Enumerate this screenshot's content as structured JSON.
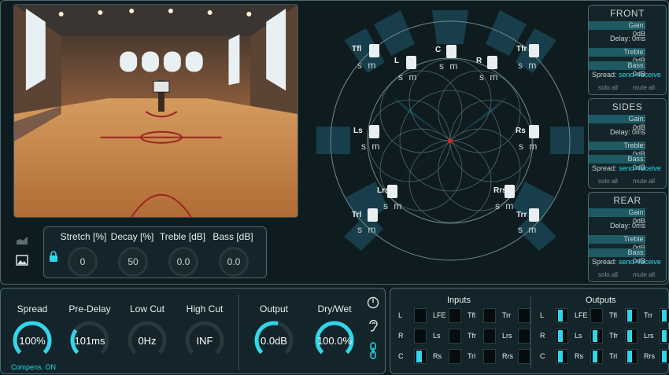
{
  "colors": {
    "accent": "#30d7ea",
    "bg": "#101d20",
    "panel": "#13252a",
    "border": "#4f6b70"
  },
  "reverb": {
    "params": [
      {
        "label": "Stretch [%]",
        "value": "0"
      },
      {
        "label": "Decay [%]",
        "value": "50"
      },
      {
        "label": "Treble [dB]",
        "value": "0.0"
      },
      {
        "label": "Bass [dB]",
        "value": "0.0"
      }
    ]
  },
  "speakers": {
    "mute_label": "s m",
    "items": [
      {
        "id": "Tfl",
        "name": "Tfl"
      },
      {
        "id": "L",
        "name": "L"
      },
      {
        "id": "C",
        "name": "C"
      },
      {
        "id": "R",
        "name": "R"
      },
      {
        "id": "Tfr",
        "name": "Tfr"
      },
      {
        "id": "Ls",
        "name": "Ls"
      },
      {
        "id": "Rs",
        "name": "Rs"
      },
      {
        "id": "Lrs",
        "name": "Lrs"
      },
      {
        "id": "Rrs",
        "name": "Rrs"
      },
      {
        "id": "Trl",
        "name": "Trl"
      },
      {
        "id": "Trr",
        "name": "Trr"
      }
    ]
  },
  "groups": [
    {
      "title": "FRONT",
      "gain": "Gain: 0dB",
      "delay": "Delay: 0ms",
      "treble": "Treble: 0dB",
      "bass": "Bass: 0dB",
      "spread_label": "Spread:",
      "spread_value": "send+receive",
      "solo": "solo all",
      "mute": "mute all"
    },
    {
      "title": "SIDES",
      "gain": "Gain: 0dB",
      "delay": "Delay: 0ms",
      "treble": "Treble: 0dB",
      "bass": "Bass: 0dB",
      "spread_label": "Spread:",
      "spread_value": "send+receive",
      "solo": "solo all",
      "mute": "mute all"
    },
    {
      "title": "REAR",
      "gain": "Gain: 0dB",
      "delay": "Delay: 0ms",
      "treble": "Treble: 0dB",
      "bass": "Bass: 0dB",
      "spread_label": "Spread:",
      "spread_value": "send+receive",
      "solo": "solo all",
      "mute": "mute all"
    }
  ],
  "knobs": [
    {
      "label": "Spread",
      "value": "100%",
      "level": 1.0
    },
    {
      "label": "Pre-Delay",
      "value": "101ms",
      "level": 0.3
    },
    {
      "label": "Low Cut",
      "value": "0Hz",
      "level": 0.0
    },
    {
      "label": "High Cut",
      "value": "INF",
      "level": 0.0
    },
    {
      "label": "Output",
      "value": "0.0dB",
      "level": 0.55
    },
    {
      "label": "Dry/Wet",
      "value": "100.0%",
      "level": 1.0
    }
  ],
  "compens": "Compens. ON",
  "io": {
    "inputs_title": "Inputs",
    "outputs_title": "Outputs",
    "inputs": [
      {
        "name": "L",
        "level": 0
      },
      {
        "name": "LFE",
        "level": 0
      },
      {
        "name": "Tfl",
        "level": 0
      },
      {
        "name": "Trr",
        "level": 0
      },
      {
        "name": "R",
        "level": 0
      },
      {
        "name": "Ls",
        "level": 0
      },
      {
        "name": "Tfr",
        "level": 0
      },
      {
        "name": "Lrs",
        "level": 0
      },
      {
        "name": "C",
        "level": 0.6
      },
      {
        "name": "Rs",
        "level": 0
      },
      {
        "name": "Trl",
        "level": 0
      },
      {
        "name": "Rrs",
        "level": 0
      }
    ],
    "outputs": [
      {
        "name": "L",
        "level": 0.5
      },
      {
        "name": "LFE",
        "level": 0
      },
      {
        "name": "Tfl",
        "level": 0.5
      },
      {
        "name": "Trr",
        "level": 0.5
      },
      {
        "name": "R",
        "level": 0.5
      },
      {
        "name": "Ls",
        "level": 0.5
      },
      {
        "name": "Tfr",
        "level": 0.5
      },
      {
        "name": "Lrs",
        "level": 0.5
      },
      {
        "name": "C",
        "level": 0.5
      },
      {
        "name": "Rs",
        "level": 0.5
      },
      {
        "name": "Trl",
        "level": 0.5
      },
      {
        "name": "Rrs",
        "level": 0.5
      }
    ]
  }
}
